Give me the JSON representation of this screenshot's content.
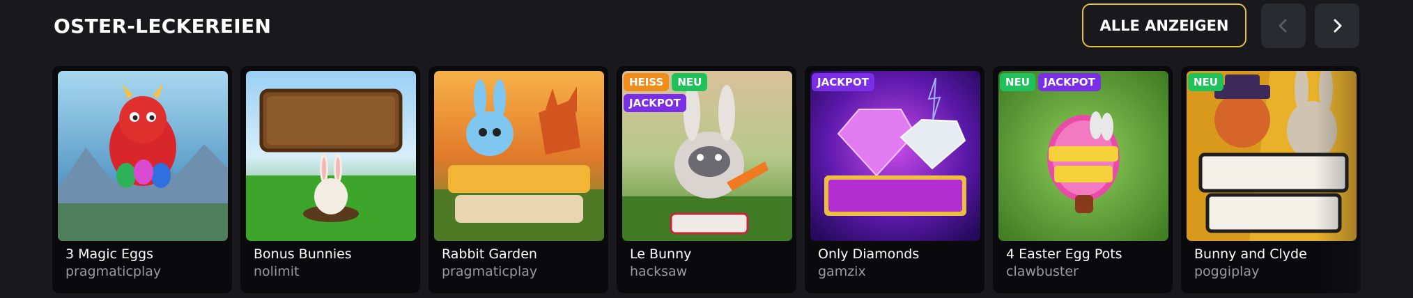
{
  "section": {
    "title": "OSTER-LECKEREIEN",
    "view_all_label": "ALLE ANZEIGEN"
  },
  "nav": {
    "prev_icon": "chevron-left-icon",
    "next_icon": "chevron-right-icon"
  },
  "colors": {
    "background": "#18181d",
    "accent_border": "#e3c13a",
    "badge_hot": "#f08c1a",
    "badge_new": "#20c15a",
    "badge_jackpot": "#7a2ee6"
  },
  "games": [
    {
      "name": "3 Magic Eggs",
      "provider": "pragmaticplay",
      "badges": [],
      "art_title": "3 MAGIC EGGS"
    },
    {
      "name": "Bonus Bunnies",
      "provider": "nolimit",
      "badges": [],
      "art_title": "BONUS BUNNIES"
    },
    {
      "name": "Rabbit Garden",
      "provider": "pragmaticplay",
      "badges": [],
      "art_title": "Rabbit GARDEN"
    },
    {
      "name": "Le Bunny",
      "provider": "hacksaw",
      "badges": [
        "HEISS",
        "NEU",
        "JACKPOT"
      ],
      "art_title": "LE BUNNY"
    },
    {
      "name": "Only Diamonds",
      "provider": "gamzix",
      "badges": [
        "JACKPOT"
      ],
      "art_title": "Only DIAMONDS"
    },
    {
      "name": "4 Easter Egg Pots",
      "provider": "clawbuster",
      "badges": [
        "NEU",
        "JACKPOT"
      ],
      "art_title": "4 EASTER EGG POTS"
    },
    {
      "name": "Bunny and Clyde",
      "provider": "poggiplay",
      "badges": [
        "NEU"
      ],
      "art_title": "BUNNY & CLYDE"
    }
  ]
}
